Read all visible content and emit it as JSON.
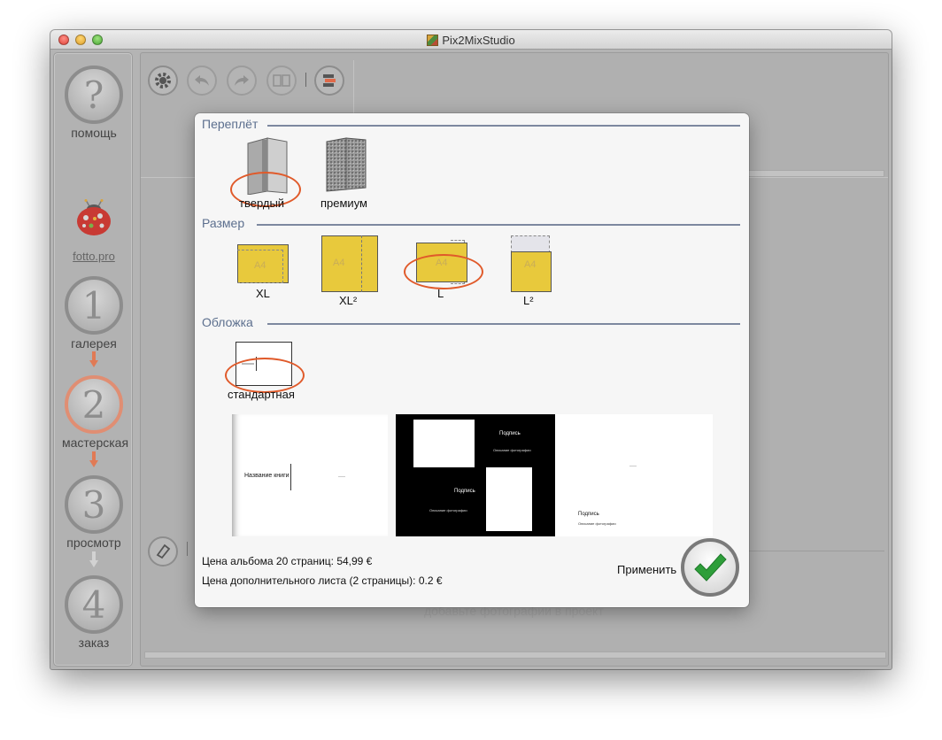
{
  "window": {
    "title": "Pix2MixStudio"
  },
  "sidebar": {
    "help": {
      "glyph": "?",
      "label": "помощь"
    },
    "fotto_link": "fotto.pro",
    "steps": [
      {
        "number": "1",
        "label": "галерея"
      },
      {
        "number": "2",
        "label": "мастерская"
      },
      {
        "number": "3",
        "label": "просмотр"
      },
      {
        "number": "4",
        "label": "заказ"
      }
    ]
  },
  "background": {
    "hint": "добавьте фотографии в проект"
  },
  "dialog": {
    "binding": {
      "title": "Переплёт",
      "options": [
        {
          "label": "твердый",
          "selected": true
        },
        {
          "label": "премиум",
          "selected": false
        }
      ]
    },
    "size": {
      "title": "Размер",
      "options": [
        {
          "label": "XL",
          "tag": "A4",
          "selected": false
        },
        {
          "label": "XL²",
          "tag": "A4",
          "selected": false
        },
        {
          "label": "L",
          "tag": "A4",
          "selected": true
        },
        {
          "label": "L²",
          "tag": "A4",
          "selected": false
        }
      ]
    },
    "cover": {
      "title": "Обложка",
      "options": [
        {
          "label": "стандартная",
          "selected": true
        }
      ]
    },
    "preview": {
      "book_title": "Название книги",
      "caption_1": "Подпись",
      "photo_desc_1": "Описание фотографии",
      "caption_2": "Подпись",
      "photo_desc_2": "Описание фотографии",
      "caption_3": "Подпись",
      "photo_desc_3": "Описание фотографии"
    },
    "price_line_1": "Цена альбома 20 страниц: 54,99 €",
    "price_line_2": "Цена дополнительного листа (2 страницы): 0.2 €",
    "apply_label": "Применить"
  },
  "colors": {
    "accent_ring": "#e05a2a",
    "section_title": "#5c6f8e",
    "size_fill": "#e8c93c",
    "apply_check": "#2e9e3a"
  }
}
